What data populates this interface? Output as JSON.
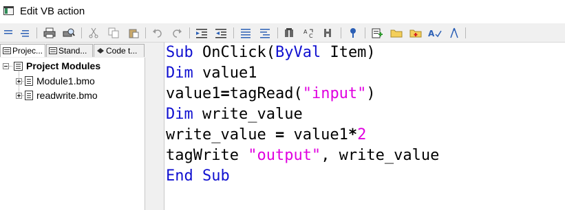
{
  "window": {
    "title": "Edit VB action"
  },
  "toolbar": {
    "icons": [
      "indent-list-icon",
      "outdent-list-icon",
      "print-icon",
      "print-preview-icon",
      "cut-icon",
      "copy-icon",
      "paste-icon",
      "undo-icon",
      "redo-icon",
      "indent-icon",
      "outdent-icon",
      "comment-block-icon",
      "uncomment-block-icon",
      "object-browser-icon",
      "find-replace-icon",
      "breakpoint-icon",
      "properties-icon",
      "insert-module-icon",
      "folder-icon",
      "add-folder-icon",
      "spell-check-icon",
      "compass-icon"
    ]
  },
  "tabs": [
    {
      "label": "Projec...",
      "active": true
    },
    {
      "label": "Stand...",
      "active": false
    },
    {
      "label": "Code t...",
      "active": false
    }
  ],
  "tree": {
    "root": "Project Modules",
    "items": [
      {
        "label": "Module1.bmo"
      },
      {
        "label": "readwrite.bmo"
      }
    ]
  },
  "code": {
    "l1": {
      "k1": "Sub",
      "t1": " OnClick(",
      "k2": "ByVal",
      "t2": " Item)"
    },
    "l2": {
      "k1": "Dim",
      "t1": " value1"
    },
    "l3": {
      "t1": "value1",
      "o1": "=",
      "t2": "tagRead(",
      "s1": "\"input\"",
      "t3": ")"
    },
    "l4": {
      "k1": "Dim",
      "t1": " write_value"
    },
    "l5": {
      "t1": "write_value ",
      "o1": "=",
      "t2": " value1",
      "o2": "*",
      "n1": "2"
    },
    "l6": {
      "t1": "tagWrite ",
      "s1": "\"output\"",
      "t2": ", write_value"
    },
    "l7": {
      "k1": "End Sub"
    }
  },
  "colors": {
    "keyword": "#1010d0",
    "string": "#e000e0",
    "toolbar_bg": "#f0f0f0"
  }
}
